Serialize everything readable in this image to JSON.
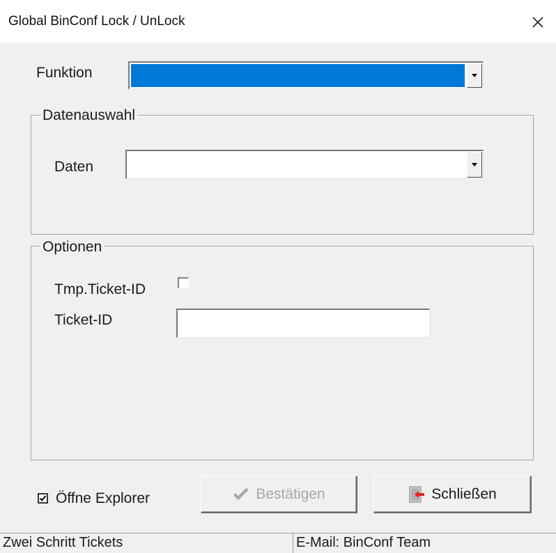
{
  "window": {
    "title": "Global BinConf Lock / UnLock",
    "close_icon": "close-icon"
  },
  "funktion": {
    "label": "Funktion",
    "selected_value": "",
    "highlight_color": "#0078d7"
  },
  "datenauswahl": {
    "legend": "Datenauswahl",
    "daten_label": "Daten",
    "daten_value": ""
  },
  "optionen": {
    "legend": "Optionen",
    "tmp_ticket_label": "Tmp.Ticket-ID",
    "tmp_ticket_checked": false,
    "ticket_id_label": "Ticket-ID",
    "ticket_id_value": ""
  },
  "footer": {
    "open_explorer_label": "Öffne Explorer",
    "open_explorer_checked": true,
    "confirm_label": "Bestätigen",
    "confirm_enabled": false,
    "close_label": "Schließen"
  },
  "statusbar": {
    "left": "Zwei Schritt Tickets",
    "right": "E-Mail: BinConf Team"
  }
}
